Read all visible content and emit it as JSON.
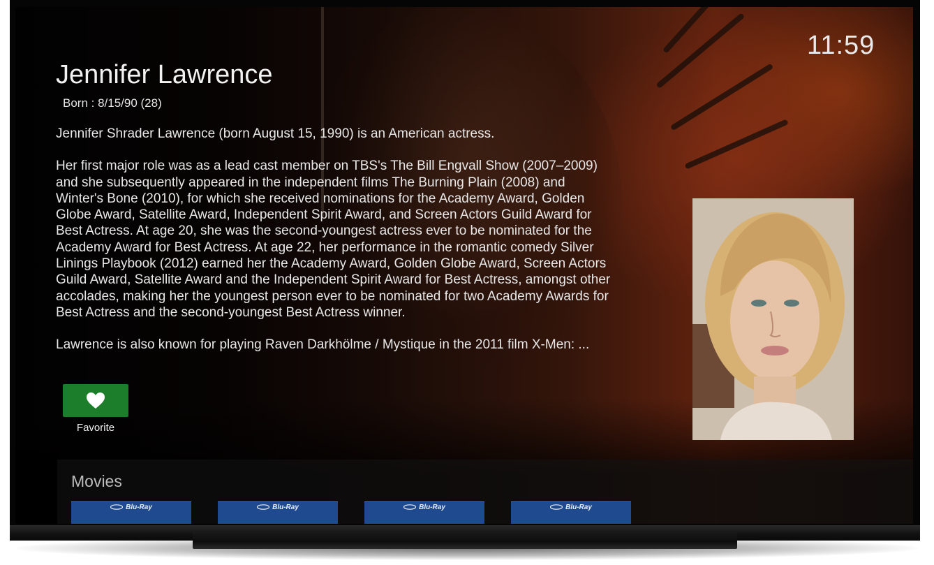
{
  "status": {
    "clock": "11:59"
  },
  "person": {
    "name": "Jennifer Lawrence",
    "born": "Born : 8/15/90 (28)",
    "bio": [
      "Jennifer Shrader Lawrence (born August 15, 1990) is an American actress.",
      "Her first major role was as a lead cast member on TBS's The Bill Engvall Show (2007–2009) and she subsequently appeared in the independent films The Burning Plain (2008) and Winter's Bone (2010), for which she received nominations for the Academy Award, Golden Globe Award, Satellite Award, Independent Spirit Award, and Screen Actors Guild Award for Best Actress. At age 20, she was the second-youngest actress ever to be nominated for the Academy Award for Best Actress. At age 22, her performance in the romantic comedy Silver Linings Playbook (2012) earned her the Academy Award, Golden Globe Award, Screen Actors Guild Award, Satellite Award and the Independent Spirit Award for Best Actress, amongst other accolades, making her the youngest person ever to be nominated for two Academy Awards for Best Actress and the second-youngest Best Actress winner.",
      "Lawrence is also known for playing Raven Darkhölme / Mystique in the 2011 film X-Men: ..."
    ]
  },
  "actions": {
    "favorite": {
      "label": "Favorite",
      "icon": "heart-icon",
      "color": "#1c7d2a"
    }
  },
  "movies": {
    "title": "Movies",
    "items": [
      {
        "badge": "Blu-Ray"
      },
      {
        "badge": "Blu-Ray"
      },
      {
        "badge": "Blu-Ray"
      },
      {
        "badge": "Blu-Ray"
      }
    ]
  }
}
